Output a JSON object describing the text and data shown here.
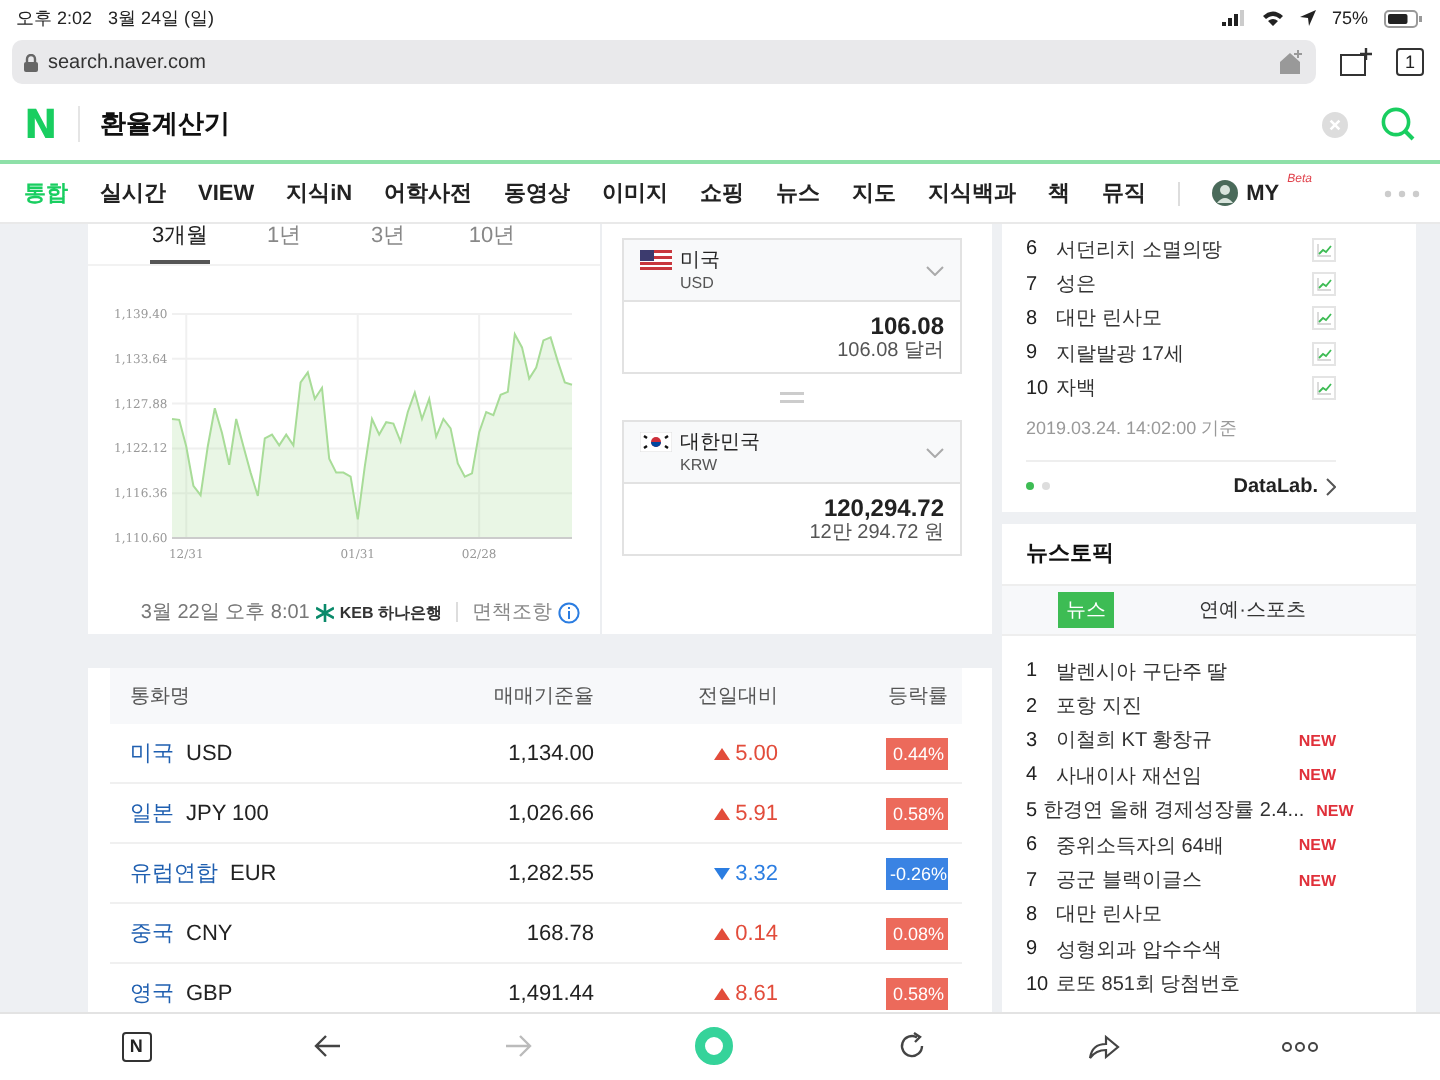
{
  "status_bar": {
    "time": "오후 2:02",
    "date": "3월 24일 (일)",
    "battery": "75%"
  },
  "address_bar": {
    "url": "search.naver.com",
    "tab_count": "1"
  },
  "search": {
    "logo": "N",
    "query": "환율계산기"
  },
  "nav_tabs": [
    {
      "label": "통합",
      "selected": true
    },
    {
      "label": "실시간",
      "selected": false
    },
    {
      "label": "VIEW",
      "selected": false
    },
    {
      "label": "지식iN",
      "selected": false
    },
    {
      "label": "어학사전",
      "selected": false
    },
    {
      "label": "동영상",
      "selected": false
    },
    {
      "label": "이미지",
      "selected": false
    },
    {
      "label": "쇼핑",
      "selected": false
    },
    {
      "label": "뉴스",
      "selected": false
    },
    {
      "label": "지도",
      "selected": false
    },
    {
      "label": "지식백과",
      "selected": false
    },
    {
      "label": "책",
      "selected": false
    },
    {
      "label": "뮤직",
      "selected": false
    }
  ],
  "my_tab": {
    "label": "MY",
    "badge": "Beta"
  },
  "period_tabs": [
    {
      "label": "3개월",
      "selected": true
    },
    {
      "label": "1년",
      "selected": false
    },
    {
      "label": "3년",
      "selected": false
    },
    {
      "label": "10년",
      "selected": false
    }
  ],
  "chart": {
    "chart_data": {
      "type": "area",
      "categories": [
        null,
        null,
        "12/31",
        null,
        null,
        null,
        null,
        null,
        null,
        null,
        null,
        null,
        null,
        null,
        null,
        null,
        null,
        null,
        null,
        null,
        null,
        null,
        null,
        null,
        null,
        null,
        "01/31",
        null,
        null,
        null,
        null,
        null,
        null,
        null,
        null,
        null,
        null,
        null,
        null,
        null,
        null,
        null,
        null,
        "02/28",
        null,
        null,
        null,
        null,
        null,
        null,
        null,
        null,
        null,
        null,
        null,
        null,
        null
      ],
      "series": [
        {
          "color": "#a8dc98",
          "values": [
            1125.9,
            1125.8,
            1122.4,
            1117.3,
            1116.1,
            1122.4,
            1127.3,
            1124.1,
            1120.0,
            1125.9,
            1122.4,
            1119.0,
            1116.0,
            1123.4,
            1123.9,
            1122.5,
            1123.9,
            1122.5,
            1130.6,
            1131.9,
            1128.5,
            1129.9,
            1120.8,
            1119.0,
            1119.0,
            1118.5,
            1113.0,
            1119.8,
            1125.9,
            1123.9,
            1125.5,
            1125.3,
            1123.0,
            1126.8,
            1129.3,
            1125.9,
            1128.5,
            1123.6,
            1125.9,
            1124.7,
            1120.2,
            1118.5,
            1118.9,
            1124.2,
            1126.8,
            1126.4,
            1129.0,
            1129.4,
            1136.8,
            1135.1,
            1131.1,
            1132.5,
            1136.0,
            1136.4,
            1133.3,
            1130.6,
            1130.3
          ]
        }
      ],
      "ylim": [
        1110.6,
        1139.4
      ],
      "grid": true,
      "yticks": [
        {
          "value": 1139.4,
          "label": "1,139.40"
        },
        {
          "value": 1133.64,
          "label": "1,133.64"
        },
        {
          "value": 1127.88,
          "label": "1,127.88"
        },
        {
          "value": 1122.12,
          "label": "1,122.12"
        },
        {
          "value": 1116.36,
          "label": "1,116.36"
        },
        {
          "value": 1110.6,
          "label": "1,110.60"
        }
      ]
    }
  },
  "source": {
    "updated": "3월 22일 오후 8:01",
    "bank": "KEB 하나은행",
    "disclaimer": "면책조항"
  },
  "converter": [
    {
      "kind": "us",
      "country": "미국",
      "code": "USD",
      "amount": "106.08",
      "amount_words": "106.08 달러"
    },
    {
      "kind": "kr",
      "country": "대한민국",
      "code": "KRW",
      "amount": "120,294.72",
      "amount_words": "12만 294.72 원"
    }
  ],
  "rates_table": {
    "columns": [
      "통화명",
      "매매기준율",
      "전일대비",
      "등락률"
    ],
    "rows": [
      {
        "country": "미국",
        "code": "USD",
        "rate": "1,134.00",
        "kind": "up",
        "change": "5.00",
        "percent": "0.44%"
      },
      {
        "country": "일본",
        "code": "JPY 100",
        "rate": "1,026.66",
        "kind": "up",
        "change": "5.91",
        "percent": "0.58%"
      },
      {
        "country": "유럽연합",
        "code": "EUR",
        "rate": "1,282.55",
        "kind": "down",
        "change": "3.32",
        "percent": "-0.26%"
      },
      {
        "country": "중국",
        "code": "CNY",
        "rate": "168.78",
        "kind": "up",
        "change": "0.14",
        "percent": "0.08%"
      },
      {
        "country": "영국",
        "code": "GBP",
        "rate": "1,491.44",
        "kind": "up",
        "change": "8.61",
        "percent": "0.58%"
      }
    ]
  },
  "trending": {
    "items": [
      {
        "rank": "6",
        "title": "서던리치 소멸의땅"
      },
      {
        "rank": "7",
        "title": "성은"
      },
      {
        "rank": "8",
        "title": "대만 린사모"
      },
      {
        "rank": "9",
        "title": "지랄발광 17세"
      },
      {
        "rank": "10",
        "title": "자백"
      }
    ],
    "timestamp": "2019.03.24. 14:02:00 기준",
    "pages": [
      {
        "selected": true
      },
      {
        "selected": false
      }
    ],
    "link": "DataLab."
  },
  "news_topic": {
    "title": "뉴스토픽",
    "tabs": [
      {
        "label": "뉴스",
        "selected": true
      },
      {
        "label": "연예·스포츠",
        "selected": false
      }
    ],
    "items": [
      {
        "rank": "1",
        "title": "발렌시아 구단주 딸"
      },
      {
        "rank": "2",
        "title": "포항 지진"
      },
      {
        "rank": "3",
        "title": "이철희 KT 황창규",
        "badge": "NEW"
      },
      {
        "rank": "4",
        "title": "사내이사 재선임",
        "badge": "NEW"
      },
      {
        "rank": "5",
        "title": "한경연 올해 경제성장률 2.4...",
        "badge": "NEW"
      },
      {
        "rank": "6",
        "title": "중위소득자의 64배",
        "badge": "NEW"
      },
      {
        "rank": "7",
        "title": "공군 블랙이글스",
        "badge": "NEW"
      },
      {
        "rank": "8",
        "title": "대만 린사모"
      },
      {
        "rank": "9",
        "title": "성형외과 압수수색"
      },
      {
        "rank": "10",
        "title": "로또 851회 당첨번호"
      }
    ]
  },
  "toolbar": {
    "home_label": "N"
  }
}
